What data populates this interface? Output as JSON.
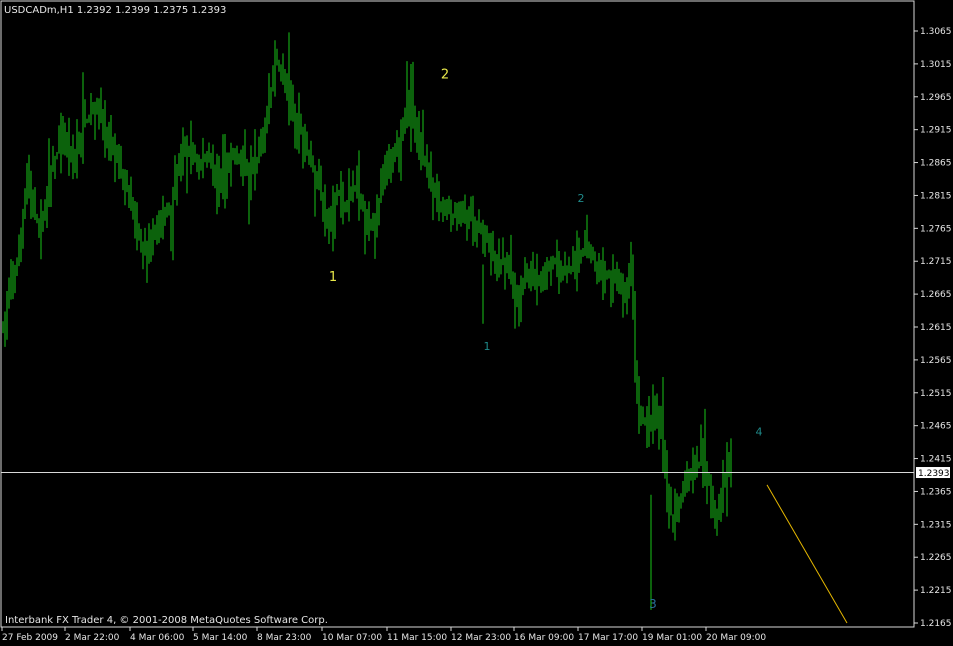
{
  "header": {
    "symbol_info": "USDCADm,H1  1.2392 1.2399 1.2375 1.2393"
  },
  "footer": {
    "copyright": "Interbank FX Trader 4, © 2001-2008 MetaQuotes Software Corp."
  },
  "colors": {
    "background": "#000000",
    "bars": "#19c419",
    "axis": "#d9d9d9",
    "price_line": "#d9d9d9",
    "trend_line": "#e6b800",
    "wave_primary": "#e8e84a",
    "wave_secondary": "#1f8a8a"
  },
  "chart_data": {
    "type": "ohlc",
    "symbol": "USDCADm",
    "timeframe": "H1",
    "current_price": "1.2393",
    "ylim": [
      1.2165,
      1.3065
    ],
    "y_ticks": [
      "1.3065",
      "1.3015",
      "1.2965",
      "1.2915",
      "1.2865",
      "1.2815",
      "1.2765",
      "1.2715",
      "1.2665",
      "1.2615",
      "1.2565",
      "1.2515",
      "1.2465",
      "1.2415",
      "1.2365",
      "1.2315",
      "1.2265",
      "1.2215",
      "1.2165"
    ],
    "x_ticks": [
      "27 Feb 2009",
      "2 Mar 22:00",
      "4 Mar 06:00",
      "5 Mar 14:00",
      "8 Mar 23:00",
      "10 Mar 07:00",
      "11 Mar 15:00",
      "12 Mar 23:00",
      "16 Mar 09:00",
      "17 Mar 17:00",
      "19 Mar 01:00",
      "20 Mar 09:00"
    ],
    "path_nodes": [
      [
        0,
        1.261
      ],
      [
        4,
        1.268
      ],
      [
        8,
        1.272
      ],
      [
        12,
        1.285
      ],
      [
        15,
        1.279
      ],
      [
        19,
        1.276
      ],
      [
        24,
        1.286
      ],
      [
        30,
        1.29
      ],
      [
        35,
        1.286
      ],
      [
        40,
        1.292
      ],
      [
        46,
        1.295
      ],
      [
        52,
        1.29
      ],
      [
        58,
        1.286
      ],
      [
        64,
        1.28
      ],
      [
        68,
        1.275
      ],
      [
        72,
        1.272
      ],
      [
        76,
        1.277
      ],
      [
        80,
        1.278
      ],
      [
        84,
        1.28
      ],
      [
        88,
        1.287
      ],
      [
        93,
        1.289
      ],
      [
        98,
        1.286
      ],
      [
        102,
        1.288
      ],
      [
        106,
        1.284
      ],
      [
        110,
        1.282
      ],
      [
        114,
        1.288
      ],
      [
        118,
        1.287
      ],
      [
        122,
        1.285
      ],
      [
        126,
        1.286
      ],
      [
        130,
        1.29
      ],
      [
        133,
        1.295
      ],
      [
        136,
        1.302
      ],
      [
        140,
        1.299
      ],
      [
        144,
        1.296
      ],
      [
        148,
        1.292
      ],
      [
        152,
        1.288
      ],
      [
        156,
        1.285
      ],
      [
        160,
        1.28
      ],
      [
        163,
        1.276
      ],
      [
        167,
        1.282
      ],
      [
        171,
        1.28
      ],
      [
        175,
        1.283
      ],
      [
        179,
        1.28
      ],
      [
        183,
        1.277
      ],
      [
        187,
        1.279
      ],
      [
        191,
        1.285
      ],
      [
        195,
        1.287
      ],
      [
        199,
        1.29
      ],
      [
        203,
        1.295
      ],
      [
        207,
        1.291
      ],
      [
        211,
        1.286
      ],
      [
        215,
        1.282
      ],
      [
        219,
        1.279
      ],
      [
        223,
        1.279
      ],
      [
        227,
        1.278
      ],
      [
        231,
        1.279
      ],
      [
        235,
        1.278
      ],
      [
        239,
        1.276
      ],
      [
        243,
        1.274
      ],
      [
        247,
        1.27
      ],
      [
        251,
        1.272
      ],
      [
        255,
        1.268
      ],
      [
        258,
        1.266
      ],
      [
        261,
        1.27
      ],
      [
        265,
        1.269
      ],
      [
        268,
        1.268
      ],
      [
        272,
        1.27
      ],
      [
        276,
        1.272
      ],
      [
        280,
        1.27
      ],
      [
        284,
        1.27
      ],
      [
        288,
        1.272
      ],
      [
        292,
        1.274
      ],
      [
        296,
        1.271
      ],
      [
        300,
        1.27
      ],
      [
        304,
        1.269
      ],
      [
        308,
        1.268
      ],
      [
        311,
        1.266
      ],
      [
        314,
        1.272
      ],
      [
        316,
        1.256
      ],
      [
        318,
        1.248
      ],
      [
        322,
        1.247
      ],
      [
        326,
        1.249
      ],
      [
        330,
        1.244
      ],
      [
        333,
        1.233
      ],
      [
        337,
        1.233
      ],
      [
        341,
        1.239
      ],
      [
        345,
        1.24
      ],
      [
        349,
        1.241
      ],
      [
        353,
        1.238
      ],
      [
        356,
        1.231
      ],
      [
        360,
        1.238
      ],
      [
        364,
        1.24
      ]
    ],
    "wave_labels": [
      {
        "text": "1",
        "price": 1.2685,
        "bar": 165,
        "color": "primary"
      },
      {
        "text": "2",
        "price": 1.2993,
        "bar": 221,
        "color": "primary"
      },
      {
        "text": "1",
        "price": 1.258,
        "bar": 242,
        "color": "secondary"
      },
      {
        "text": "2",
        "price": 1.2805,
        "bar": 289,
        "color": "secondary"
      },
      {
        "text": "3",
        "price": 1.2188,
        "bar": 325,
        "color": "tertiary"
      },
      {
        "text": "4",
        "price": 1.245,
        "bar": 378,
        "color": "secondary"
      }
    ],
    "trend_line": {
      "from_bar": 382,
      "from_price": 1.2375,
      "to_bar": 422,
      "to_price": 1.2165
    }
  }
}
